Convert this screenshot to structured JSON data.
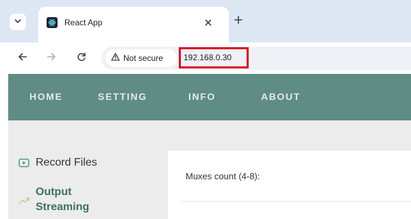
{
  "browser": {
    "tab": {
      "title": "React App",
      "favicon": "react-atom-icon"
    },
    "address_bar": {
      "security_label": "Not secure",
      "url": "192.168.0.30"
    }
  },
  "app": {
    "nav": {
      "home": "HOME",
      "setting": "SETTING",
      "info": "INFO",
      "about": "ABOUT"
    },
    "sidebar": {
      "items": [
        {
          "label": "Record Files",
          "icon": "play-box-icon"
        },
        {
          "label": "Output Streaming",
          "icon": "trend-line-icon"
        }
      ]
    },
    "content": {
      "muxes_label": "Muxes count (4-8):"
    }
  },
  "colors": {
    "nav_background": "#5f8c85",
    "accent_text": "#3f6f67",
    "highlight_box": "#e0001a",
    "tab_strip": "#dde6f3"
  }
}
